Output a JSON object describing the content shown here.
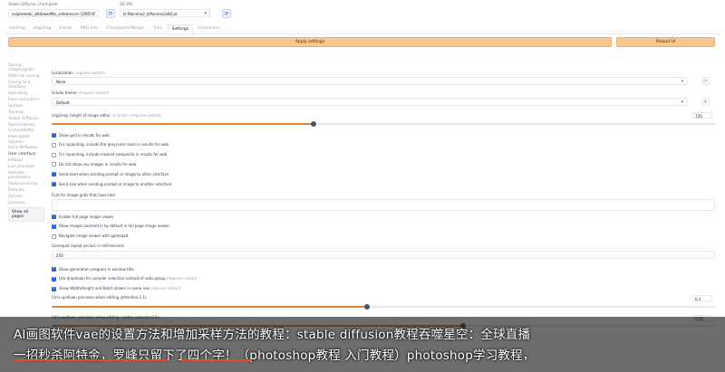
{
  "top": {
    "checkpoint_label": "Stable Diffusion checkpoint",
    "checkpoint_value": "xxlplesketo_xl8dakedf8x_safetensors [2f8554",
    "vae_label": "SD VAE",
    "vae_value": "kl-f8anime2_ktPanimo2s8d.pt"
  },
  "tabs": [
    "txt2img",
    "img2img",
    "Extras",
    "PNG Info",
    "Checkpoint Merger",
    "Train",
    "Settings",
    "Extensions"
  ],
  "buttons": {
    "apply": "Apply settings",
    "reload": "Reload UI"
  },
  "sidebar": {
    "items": [
      "Saving images/grids",
      "Paths for saving",
      "Saving to a directory",
      "Upscaling",
      "Face restoration",
      "System",
      "Training",
      "Stable Diffusion",
      "Optimizations",
      "Compatibility",
      "Interrogate Options",
      "Extra Networks",
      "User interface",
      "Infotext",
      "Live previews",
      "Sampler parameters",
      "Postprocessing",
      "Defaults",
      "Actions",
      "Licenses"
    ],
    "active_index": 12,
    "show_all": "Show all pages"
  },
  "settings": {
    "localization_label": "Localization",
    "localization_req": "(requires restart)",
    "localization_value": "None",
    "gradio_theme_label": "Gradio theme",
    "gradio_theme_req": "(requires restart)",
    "gradio_theme_value": "Default",
    "img2img_height_label": "img2img: height of image editor",
    "img2img_height_req": "(in pixels) (requires restart)",
    "img2img_height_value": "720",
    "img2img_height_fraction": 0.395,
    "checkboxes_a": [
      {
        "label": "Show grid in results for web",
        "req": "",
        "on": true
      },
      {
        "label": "For inpainting, include the greyscale mask in results for web",
        "req": "",
        "on": false
      },
      {
        "label": "For inpainting, include masked composite in results for web",
        "req": "",
        "on": false
      },
      {
        "label": "Do not show any images in results for web",
        "req": "",
        "on": false
      },
      {
        "label": "Send seed when sending prompt or image to other interface",
        "req": "",
        "on": true
      },
      {
        "label": "Send size when sending prompt or image to another interface",
        "req": "",
        "on": true
      }
    ],
    "font_label": "Font for image grids that have text",
    "checkboxes_b": [
      {
        "label": "Enable full page image viewer",
        "req": "",
        "on": true
      },
      {
        "label": "Show images zoomed in by default in full page image viewer",
        "req": "",
        "on": true
      },
      {
        "label": "Navigate image viewer with gamepad",
        "req": "",
        "on": false
      }
    ],
    "gamepad_label": "Gamepad repeat period, in milliseconds",
    "gamepad_value": "250",
    "checkboxes_c": [
      {
        "label": "Show generation progress in window title.",
        "req": "",
        "on": true
      },
      {
        "label": "Use dropdown for sampler selection instead of radio group",
        "req": "(requires restart)",
        "on": true
      },
      {
        "label": "Show Width/Height and Batch sliders in same row",
        "req": "(requires restart)",
        "on": true
      }
    ],
    "ctrl_up_label": "Ctrl+up/down precision when editing (attention:1.1)",
    "ctrl_up_value": "0.1",
    "ctrl_up_fraction": 0.1,
    "ctrl_up2_label": "Ctrl+up/down precision when editing <extra networks:0.9>",
    "ctrl_up2_value": "0.05",
    "ctrl_up2_fraction": 0.05
  },
  "caption": {
    "line1": "AI画图软件vae的设置方法和增加采样方法的教程：stable diffusion教程吞噬星空：全球直播",
    "line2": "一招秒杀阿特金，罗峰只留下了四个字！（photoshop教程 入门教程）photoshop学习教程，"
  }
}
